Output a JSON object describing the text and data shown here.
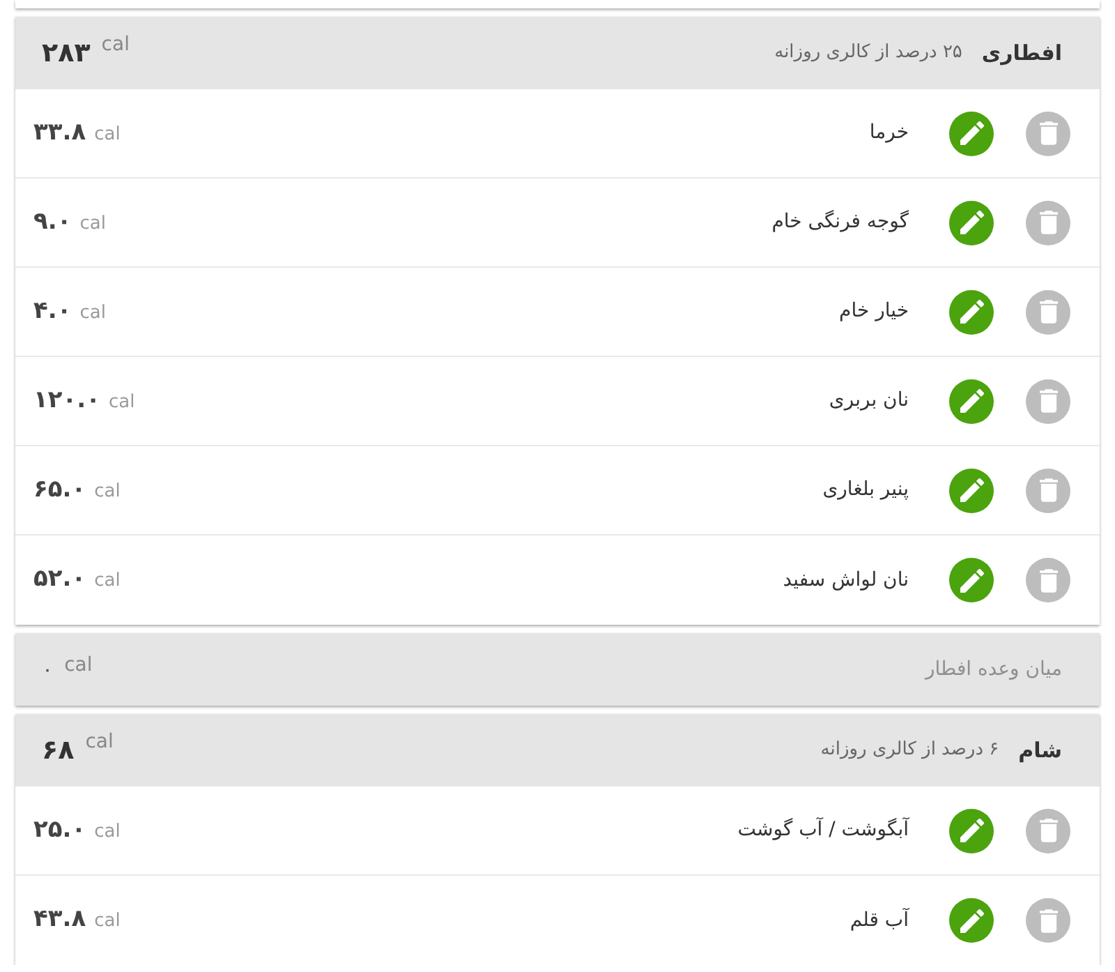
{
  "meals": [
    {
      "title": "افطاری",
      "subtitle": "۲۵ درصد از کالری روزانه",
      "calories": "۲۸۳",
      "unit": "cal",
      "items": [
        {
          "name": "خرما",
          "calories": "۳۳.۸",
          "unit": "cal"
        },
        {
          "name": "گوجه فرنگی خام",
          "calories": "۹.۰",
          "unit": "cal"
        },
        {
          "name": "خیار خام",
          "calories": "۴.۰",
          "unit": "cal"
        },
        {
          "name": "نان بربری",
          "calories": "۱۲۰.۰",
          "unit": "cal"
        },
        {
          "name": "پنیر بلغاری",
          "calories": "۶۵.۰",
          "unit": "cal"
        },
        {
          "name": "نان لواش سفید",
          "calories": "۵۲.۰",
          "unit": "cal"
        }
      ]
    },
    {
      "title": "میان وعده افطار",
      "calories": "۰",
      "unit": "cal"
    },
    {
      "title": "شام",
      "subtitle": "۶ درصد از کالری روزانه",
      "calories": "۶۸",
      "unit": "cal",
      "items": [
        {
          "name": "آبگوشت / آب گوشت",
          "calories": "۲۵.۰",
          "unit": "cal"
        },
        {
          "name": "آب قلم",
          "calories": "۴۳.۸",
          "unit": "cal"
        }
      ]
    }
  ]
}
